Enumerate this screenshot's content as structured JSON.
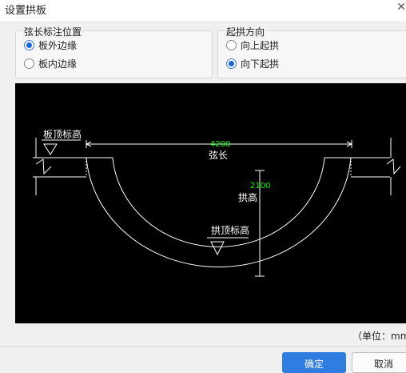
{
  "window": {
    "title": "设置拱板"
  },
  "chord_position": {
    "legend": "弦长标注位置",
    "options": [
      {
        "label": "板外边缘",
        "checked": true
      },
      {
        "label": "板内边缘",
        "checked": false
      }
    ]
  },
  "arch_direction": {
    "legend": "起拱方向",
    "options": [
      {
        "label": "向上起拱",
        "checked": false
      },
      {
        "label": "向下起拱",
        "checked": true
      }
    ]
  },
  "preview": {
    "slab_top_label": "板顶标高",
    "chord_value": "4200",
    "chord_label": "弦长",
    "rise_value": "2100",
    "rise_label": "拱高",
    "arch_top_label": "拱顶标高",
    "colors": {
      "dimension_value": "#00ff00",
      "lines": "#ffffff",
      "background": "#000000"
    }
  },
  "unit_label": "（单位：mm",
  "buttons": {
    "ok": "确定",
    "cancel": "取消"
  }
}
